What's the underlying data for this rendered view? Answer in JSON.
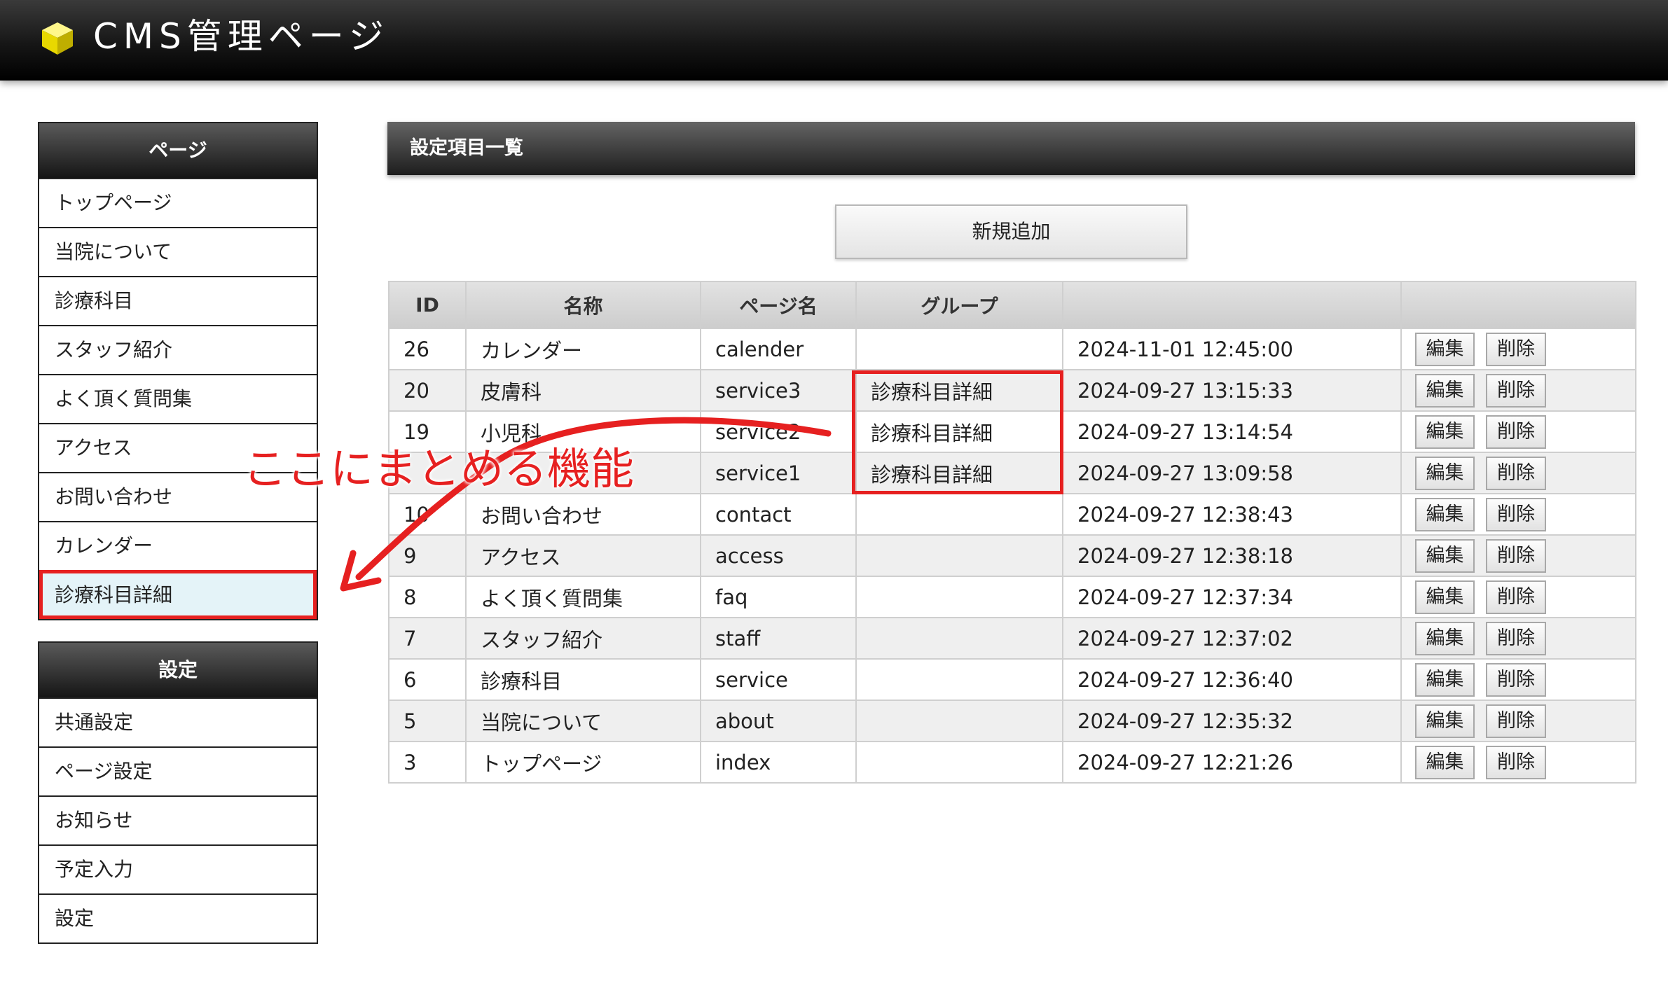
{
  "header": {
    "title": "CMS管理ページ",
    "logo_icon": "yellow-cube-icon"
  },
  "sidebar": {
    "sections": [
      {
        "title": "ページ",
        "items": [
          "トップページ",
          "当院について",
          "診療科目",
          "スタッフ紹介",
          "よく頂く質問集",
          "アクセス",
          "お問い合わせ",
          "カレンダー",
          "診療科目詳細"
        ],
        "active": "診療科目詳細"
      },
      {
        "title": "設定",
        "items": [
          "共通設定",
          "ページ設定",
          "お知らせ",
          "予定入力",
          "設定"
        ]
      }
    ]
  },
  "main": {
    "title": "設定項目一覧",
    "add_button_label": "新規追加",
    "table": {
      "columns": [
        "ID",
        "名称",
        "ページ名",
        "グループ",
        "",
        ""
      ],
      "rows": [
        {
          "id": "26",
          "name": "カレンダー",
          "page": "calender",
          "group": "",
          "date": "2024-11-01 12:45:00"
        },
        {
          "id": "20",
          "name": "皮膚科",
          "page": "service3",
          "group": "診療科目詳細",
          "date": "2024-09-27 13:15:33"
        },
        {
          "id": "19",
          "name": "小児科",
          "page": "service2",
          "group": "診療科目詳細",
          "date": "2024-09-27 13:14:54"
        },
        {
          "id": "",
          "name": "",
          "page": "service1",
          "group": "診療科目詳細",
          "date": "2024-09-27 13:09:58"
        },
        {
          "id": "10",
          "name": "お問い合わせ",
          "page": "contact",
          "group": "",
          "date": "2024-09-27 12:38:43"
        },
        {
          "id": "9",
          "name": "アクセス",
          "page": "access",
          "group": "",
          "date": "2024-09-27 12:38:18"
        },
        {
          "id": "8",
          "name": "よく頂く質問集",
          "page": "faq",
          "group": "",
          "date": "2024-09-27 12:37:34"
        },
        {
          "id": "7",
          "name": "スタッフ紹介",
          "page": "staff",
          "group": "",
          "date": "2024-09-27 12:37:02"
        },
        {
          "id": "6",
          "name": "診療科目",
          "page": "service",
          "group": "",
          "date": "2024-09-27 12:36:40"
        },
        {
          "id": "5",
          "name": "当院について",
          "page": "about",
          "group": "",
          "date": "2024-09-27 12:35:32"
        },
        {
          "id": "3",
          "name": "トップページ",
          "page": "index",
          "group": "",
          "date": "2024-09-27 12:21:26"
        }
      ],
      "edit_label": "編集",
      "delete_label": "削除"
    }
  },
  "annotation": {
    "text": "ここにまとめる機能",
    "color": "#e62020"
  },
  "colors": {
    "accent_red": "#e62020",
    "active_bg": "#e4f3f8",
    "logo_yellow": "#f2e400"
  }
}
